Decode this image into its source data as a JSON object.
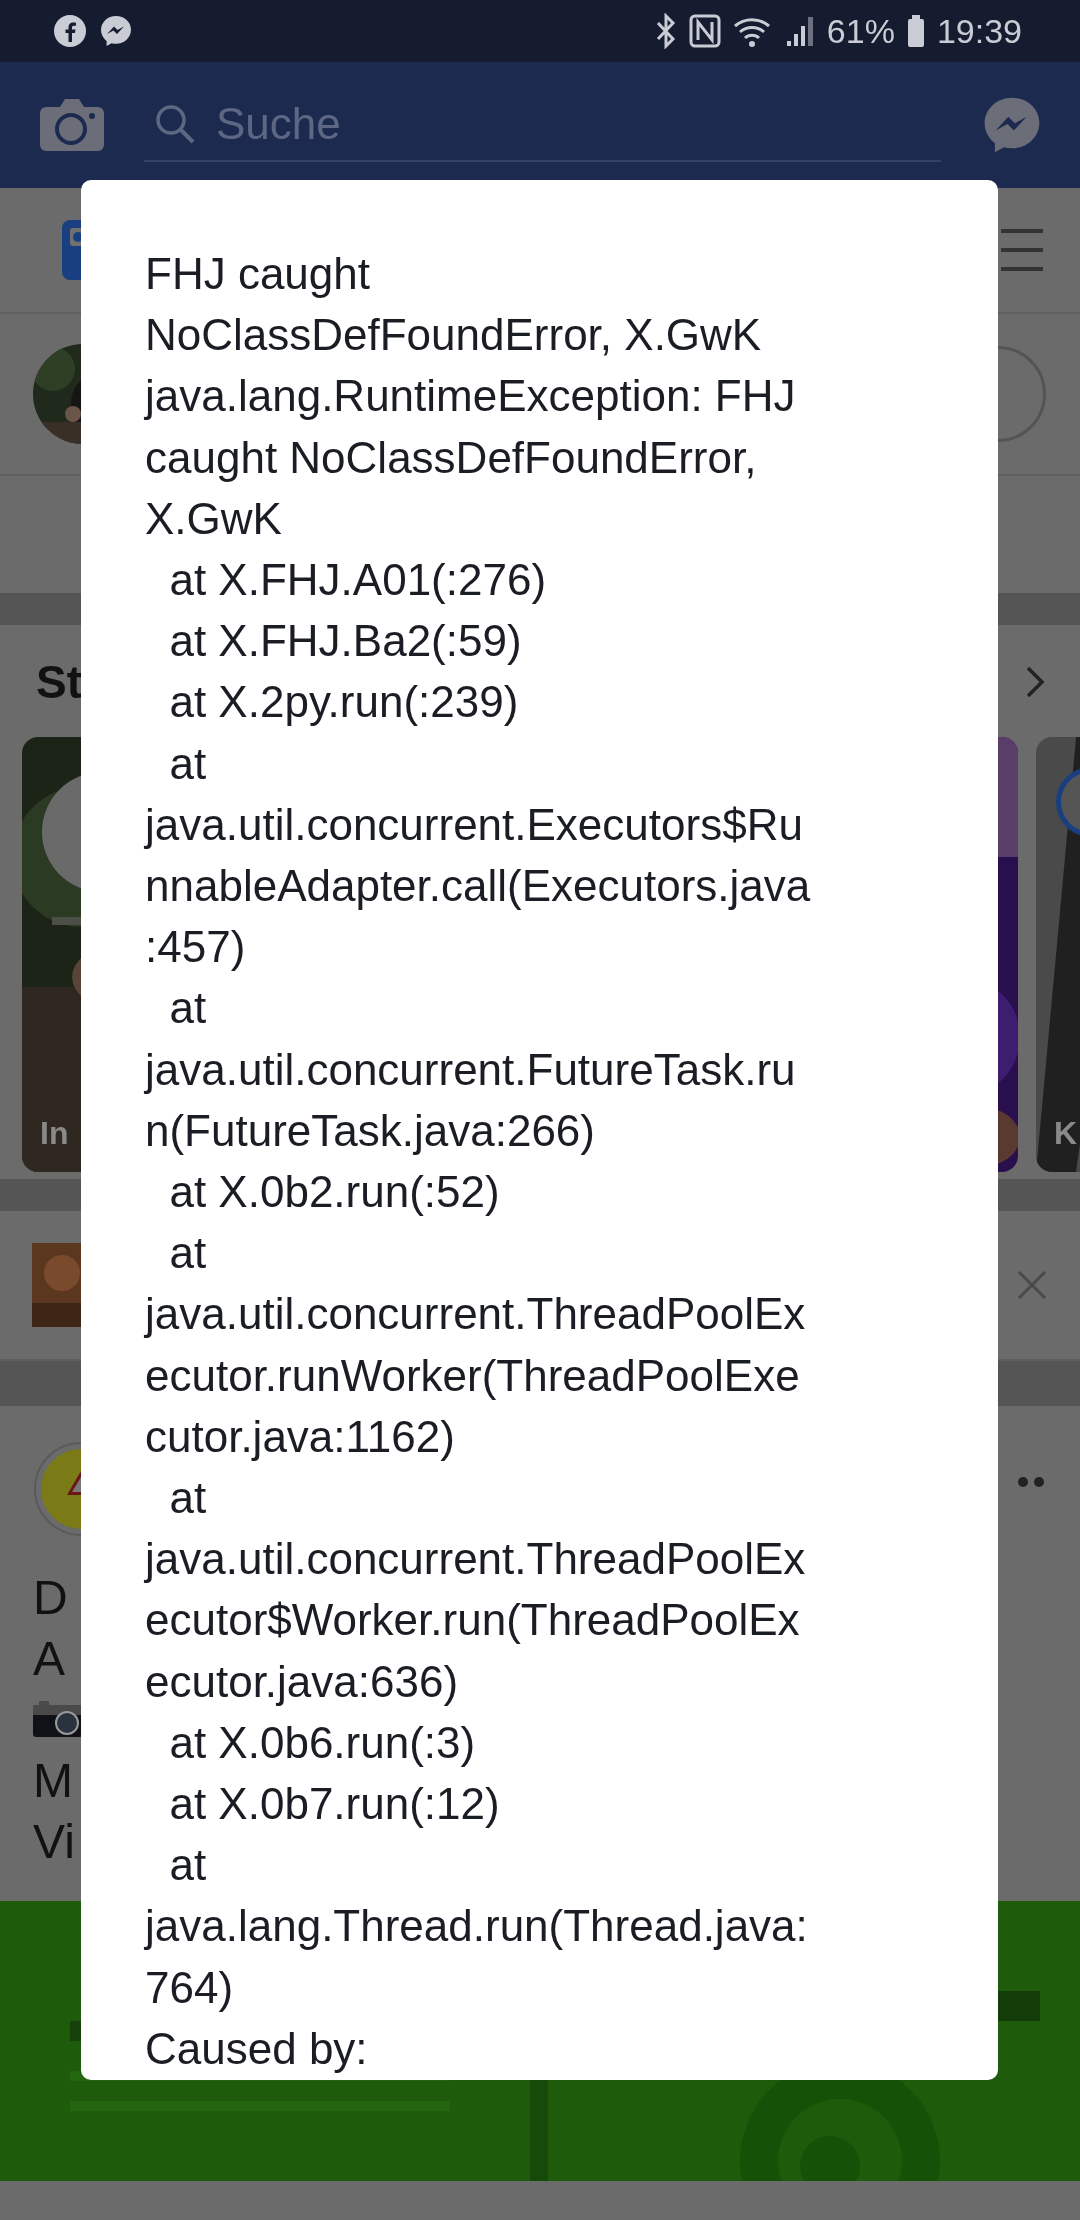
{
  "status_bar": {
    "battery": "61%",
    "time": "19:39"
  },
  "header": {
    "search": {
      "placeholder": "Suche"
    }
  },
  "feed": {
    "stories": {
      "title": "St",
      "cards": [
        {
          "label": "In",
          "kind": "add"
        },
        {
          "kind": "plain"
        },
        {
          "label": "K",
          "kind": "avatar"
        }
      ]
    },
    "post": {
      "lines": [
        {
          "kind": "text",
          "text": "D"
        },
        {
          "kind": "text",
          "text": "A"
        },
        {
          "kind": "camera"
        },
        {
          "kind": "text",
          "text": "M"
        },
        {
          "kind": "text",
          "text": "Vi"
        }
      ]
    }
  },
  "dialog": {
    "lines": [
      "FHJ caught",
      "NoClassDefFoundError, X.GwK",
      "java.lang.RuntimeException: FHJ",
      "caught NoClassDefFoundError,",
      "X.GwK",
      "  at X.FHJ.A01(:276)",
      "  at X.FHJ.Ba2(:59)",
      "  at X.2py.run(:239)",
      "  at",
      "java.util.concurrent.Executors$Ru",
      "nnableAdapter.call(Executors.java",
      ":457)",
      "  at",
      "java.util.concurrent.FutureTask.ru",
      "n(FutureTask.java:266)",
      "  at X.0b2.run(:52)",
      "  at",
      "java.util.concurrent.ThreadPoolEx",
      "ecutor.runWorker(ThreadPoolExe",
      "cutor.java:1162)",
      "  at",
      "java.util.concurrent.ThreadPoolEx",
      "ecutor$Worker.run(ThreadPoolEx",
      "ecutor.java:636)",
      "  at X.0b6.run(:3)",
      "  at X.0b7.run(:12)",
      "  at",
      "java.lang.Thread.run(Thread.java:",
      "764)",
      "Caused by:"
    ]
  }
}
